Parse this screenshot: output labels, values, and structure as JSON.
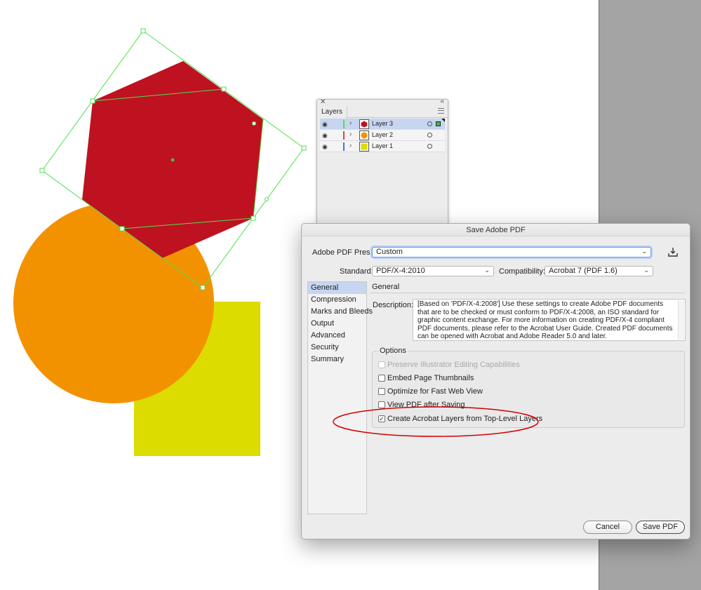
{
  "layers_panel": {
    "tab_label": "Layers",
    "layers": [
      {
        "name": "Layer 3",
        "color": "#4fe04f",
        "selected": true,
        "thumb": "hexagon"
      },
      {
        "name": "Layer 2",
        "color": "#e04545",
        "selected": false,
        "thumb": "circle"
      },
      {
        "name": "Layer 1",
        "color": "#4575e0",
        "selected": false,
        "thumb": "square"
      }
    ]
  },
  "dialog": {
    "title": "Save Adobe PDF",
    "preset_label": "Adobe PDF Preset:",
    "preset_value": "Custom",
    "standard_label": "Standard:",
    "standard_value": "PDF/X-4:2010",
    "compatibility_label": "Compatibility:",
    "compatibility_value": "Acrobat 7 (PDF 1.6)",
    "nav": [
      "General",
      "Compression",
      "Marks and Bleeds",
      "Output",
      "Advanced",
      "Security",
      "Summary"
    ],
    "section_title": "General",
    "description_label": "Description:",
    "description": "[Based on 'PDF/X-4:2008'] Use these settings to create Adobe PDF documents that are to be checked or must conform to PDF/X-4:2008, an ISO standard for graphic content exchange.  For more information on creating PDF/X-4 compliant PDF documents, please refer to the Acrobat User Guide.  Created PDF documents can be opened with Acrobat and Adobe Reader 5.0 and later.",
    "options_legend": "Options",
    "options": [
      {
        "label": "Preserve Illustrator Editing Capabilities",
        "checked": false,
        "enabled": false
      },
      {
        "label": "Embed Page Thumbnails",
        "checked": false,
        "enabled": true
      },
      {
        "label": "Optimize for Fast Web View",
        "checked": false,
        "enabled": true
      },
      {
        "label": "View PDF after Saving",
        "checked": false,
        "enabled": true
      },
      {
        "label": "Create Acrobat Layers from Top-Level Layers",
        "checked": true,
        "enabled": true
      }
    ],
    "cancel_label": "Cancel",
    "save_label": "Save PDF"
  },
  "colors": {
    "hexagon": "#be1220",
    "circle": "#f39200",
    "square": "#dcdc00",
    "selection": "#4fe04f",
    "annotation": "#d40000"
  }
}
